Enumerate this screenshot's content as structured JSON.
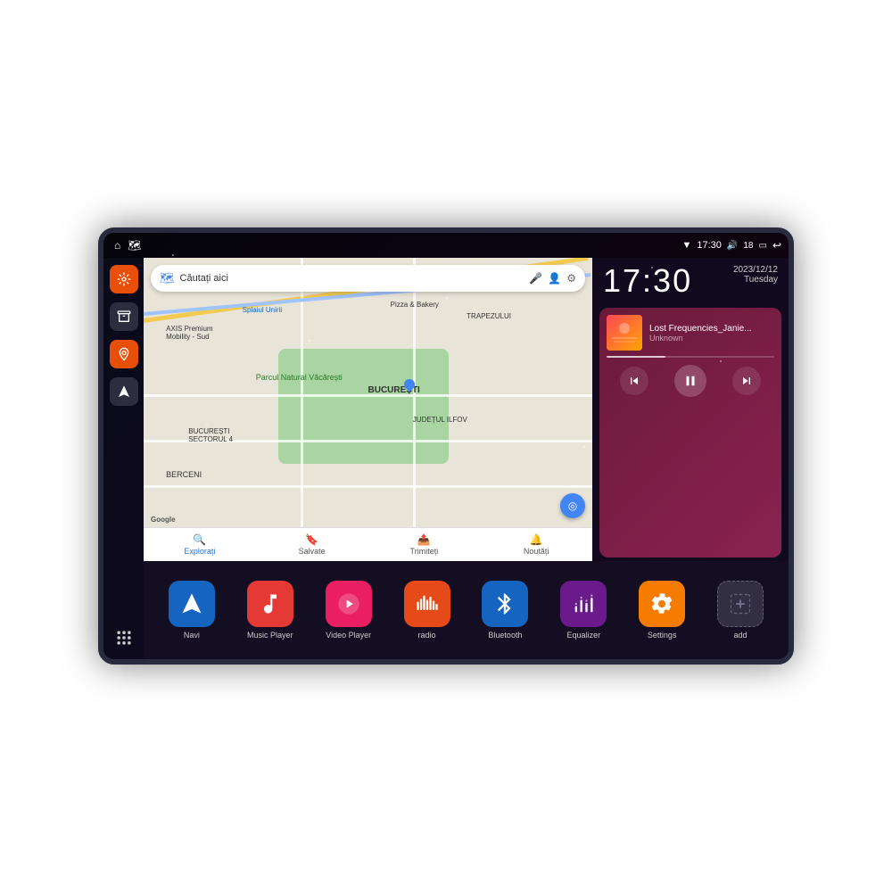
{
  "device": {
    "status_bar": {
      "wifi_icon": "wifi",
      "time": "17:30",
      "volume_icon": "volume",
      "battery_level": "18",
      "battery_icon": "battery",
      "back_icon": "back"
    },
    "sidebar": {
      "home_label": "home",
      "map_label": "map",
      "settings_label": "settings",
      "archive_label": "archive",
      "location_label": "location",
      "navigation_label": "navigation",
      "apps_label": "apps"
    },
    "map": {
      "search_placeholder": "Căutați aici",
      "search_hint": "Căutați aici",
      "labels": [
        "AXIS Premium Mobility - Sud",
        "Pizza & Bakery",
        "Parcul Natural Văcărești",
        "BUCUREȘTI",
        "BUCUREȘTI SECTORUL 4",
        "BERCENI",
        "JUDEȚUL ILFOV",
        "TRAPEZULUI"
      ],
      "bottom_items": [
        "Explorați",
        "Salvate",
        "Trimiteți",
        "Noutăți"
      ]
    },
    "clock": {
      "time": "17:30",
      "date": "2023/12/12",
      "weekday": "Tuesday"
    },
    "music": {
      "title": "Lost Frequencies_Janie...",
      "artist": "Unknown",
      "controls": {
        "prev": "⏮",
        "play_pause": "⏸",
        "next": "⏭"
      }
    },
    "apps": [
      {
        "id": "navi",
        "label": "Navi",
        "icon": "navi",
        "color": "#1565c0"
      },
      {
        "id": "music-player",
        "label": "Music Player",
        "icon": "music",
        "color": "#e53935"
      },
      {
        "id": "video-player",
        "label": "Video Player",
        "icon": "video",
        "color": "#e91e63"
      },
      {
        "id": "radio",
        "label": "radio",
        "icon": "radio",
        "color": "#e64a19"
      },
      {
        "id": "bluetooth",
        "label": "Bluetooth",
        "icon": "bluetooth",
        "color": "#1565c0"
      },
      {
        "id": "equalizer",
        "label": "Equalizer",
        "icon": "eq",
        "color": "#6a1a8a"
      },
      {
        "id": "settings",
        "label": "Settings",
        "icon": "settings",
        "color": "#f57c00"
      },
      {
        "id": "add",
        "label": "add",
        "icon": "add",
        "color": "transparent"
      }
    ]
  }
}
